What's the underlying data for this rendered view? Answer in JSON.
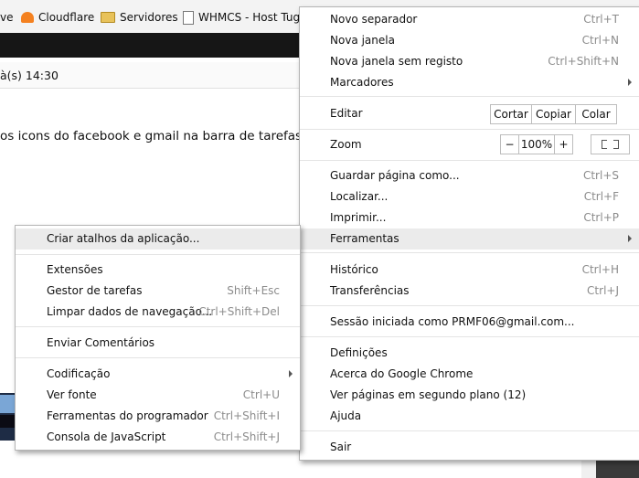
{
  "bookmarks": {
    "partial_first": "ve",
    "items": [
      {
        "label": "Cloudflare",
        "icon": "cloudflare-icon"
      },
      {
        "label": "Servidores",
        "icon": "folder-icon"
      },
      {
        "label": "WHMCS - Host Tug.",
        "icon": "page-icon"
      }
    ]
  },
  "page": {
    "info_text": "à(s) 14:30",
    "question": "os icons do facebook e gmail na barra de tarefas?"
  },
  "chrome_menu": {
    "new_tab": {
      "label": "Novo separador",
      "shortcut": "Ctrl+T"
    },
    "new_window": {
      "label": "Nova janela",
      "shortcut": "Ctrl+N"
    },
    "incognito": {
      "label": "Nova janela sem registo",
      "shortcut": "Ctrl+Shift+N"
    },
    "bookmarks": {
      "label": "Marcadores"
    },
    "edit": {
      "label": "Editar",
      "cut": "Cortar",
      "copy": "Copiar",
      "paste": "Colar"
    },
    "zoom": {
      "label": "Zoom",
      "minus": "−",
      "level": "100%",
      "plus": "+"
    },
    "save_page": {
      "label": "Guardar página como...",
      "shortcut": "Ctrl+S"
    },
    "find": {
      "label": "Localizar...",
      "shortcut": "Ctrl+F"
    },
    "print": {
      "label": "Imprimir...",
      "shortcut": "Ctrl+P"
    },
    "tools": {
      "label": "Ferramentas"
    },
    "history": {
      "label": "Histórico",
      "shortcut": "Ctrl+H"
    },
    "downloads": {
      "label": "Transferências",
      "shortcut": "Ctrl+J"
    },
    "signed_in": {
      "label": "Sessão iniciada como PRMF06@gmail.com..."
    },
    "settings": {
      "label": "Definições"
    },
    "about": {
      "label": "Acerca do Google Chrome"
    },
    "background_pages": {
      "label": "Ver páginas em segundo plano (12)"
    },
    "help": {
      "label": "Ajuda"
    },
    "exit": {
      "label": "Sair"
    }
  },
  "tools_menu": {
    "create_shortcuts": {
      "label": "Criar atalhos da aplicação..."
    },
    "extensions": {
      "label": "Extensões"
    },
    "task_manager": {
      "label": "Gestor de tarefas",
      "shortcut": "Shift+Esc"
    },
    "clear_data": {
      "label": "Limpar dados de navegação...",
      "shortcut": "Ctrl+Shift+Del"
    },
    "feedback": {
      "label": "Enviar Comentários"
    },
    "encoding": {
      "label": "Codificação"
    },
    "view_source": {
      "label": "Ver fonte",
      "shortcut": "Ctrl+U"
    },
    "dev_tools": {
      "label": "Ferramentas do programador",
      "shortcut": "Ctrl+Shift+I"
    },
    "js_console": {
      "label": "Consola de JavaScript",
      "shortcut": "Ctrl+Shift+J"
    }
  }
}
